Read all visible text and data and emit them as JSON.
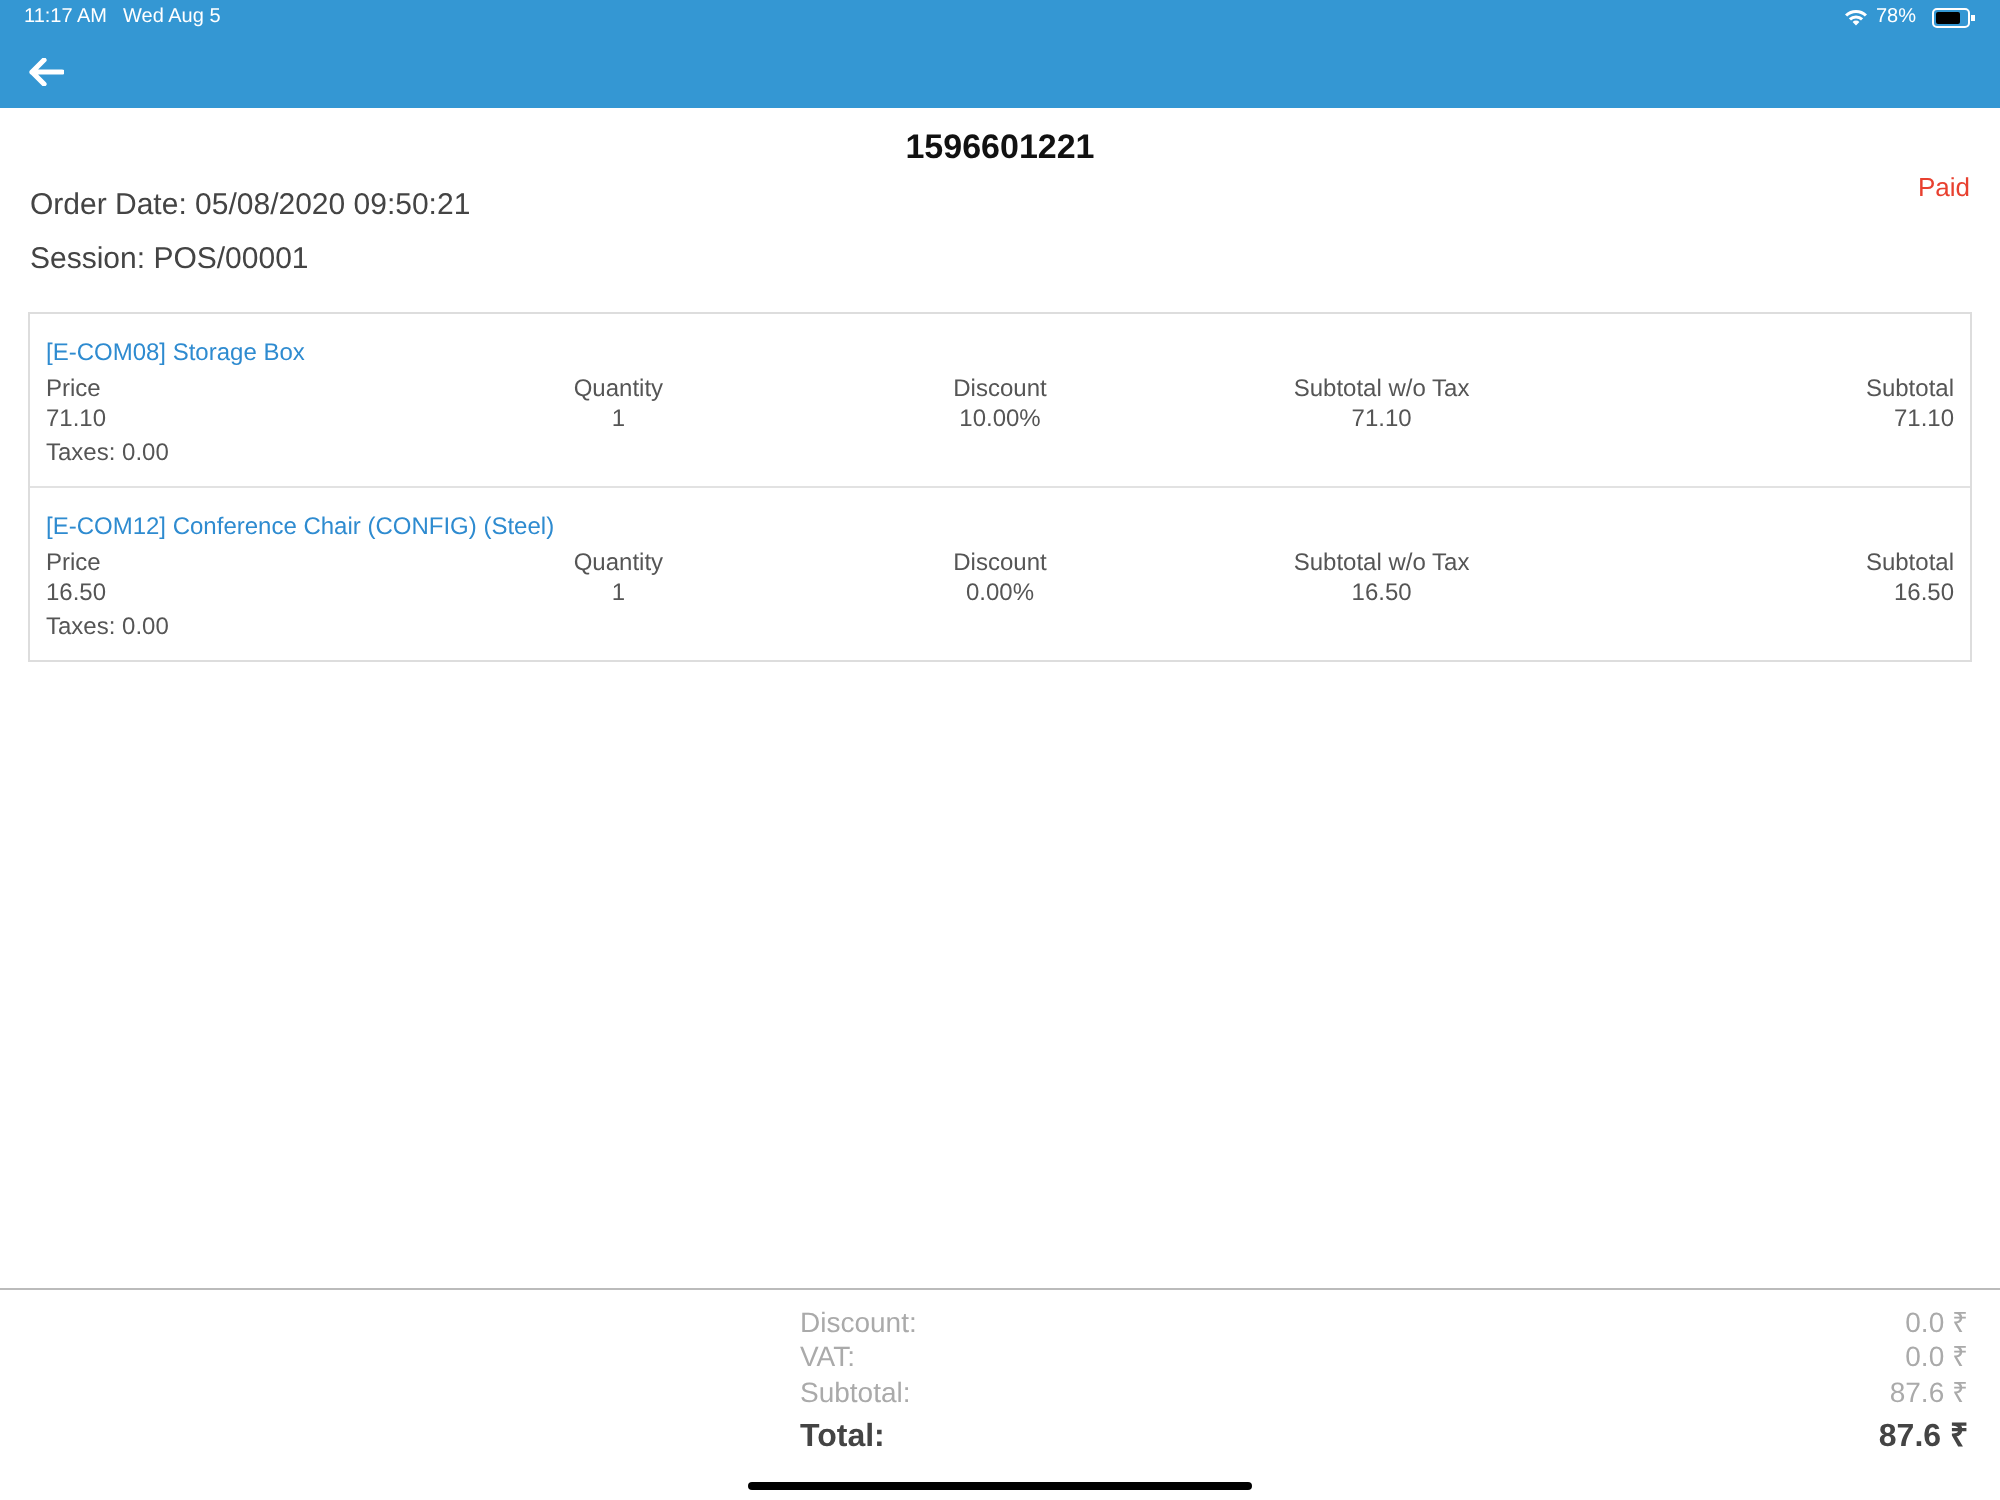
{
  "status_bar": {
    "time": "11:17 AM",
    "date": "Wed Aug 5",
    "battery": "78%"
  },
  "order": {
    "number": "1596601221",
    "order_date": "Order Date: 05/08/2020 09:50:21",
    "session": "Session: POS/00001",
    "state": "Paid"
  },
  "lines": [
    {
      "product": "[E-COM08] Storage Box",
      "fields": [
        {
          "label": "Price",
          "value": "71.10"
        },
        {
          "label": "Quantity",
          "value": "1"
        },
        {
          "label": "Discount",
          "value": "10.00%"
        },
        {
          "label": "Subtotal w/o Tax",
          "value": "71.10"
        },
        {
          "label": "Subtotal",
          "value": "71.10"
        }
      ],
      "taxes": "Taxes: 0.00"
    },
    {
      "product": "[E-COM12] Conference Chair (CONFIG) (Steel)",
      "fields": [
        {
          "label": "Price",
          "value": "16.50"
        },
        {
          "label": "Quantity",
          "value": "1"
        },
        {
          "label": "Discount",
          "value": "0.00%"
        },
        {
          "label": "Subtotal w/o Tax",
          "value": "16.50"
        },
        {
          "label": "Subtotal",
          "value": "16.50"
        }
      ],
      "taxes": "Taxes: 0.00"
    }
  ],
  "totals": [
    {
      "kind": "sub",
      "label": "Discount:",
      "value": "0.0 ₹"
    },
    {
      "kind": "sub",
      "label": "VAT:",
      "value": "0.0 ₹"
    },
    {
      "kind": "sub",
      "label": "Subtotal:",
      "value": "87.6 ₹"
    },
    {
      "kind": "total",
      "label": "Total:",
      "value": "87.6 ₹"
    }
  ]
}
